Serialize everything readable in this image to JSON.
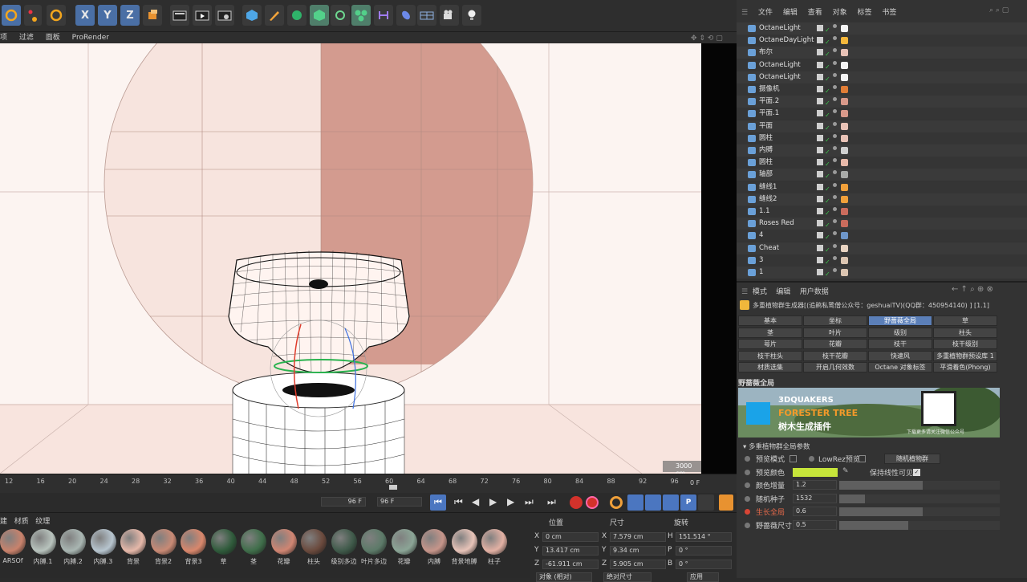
{
  "toolbar": {
    "axes": [
      "X",
      "Y",
      "Z"
    ]
  },
  "viewport_menu": [
    "项",
    "过滤",
    "面板",
    "ProRender"
  ],
  "viewport": {
    "hud_distance": "3000 cm"
  },
  "timeline": {
    "ticks": [
      "12",
      "16",
      "20",
      "24",
      "28",
      "32",
      "36",
      "40",
      "44",
      "48",
      "52",
      "56",
      "60",
      "64",
      "68",
      "72",
      "76",
      "80",
      "84",
      "88",
      "92",
      "96"
    ],
    "end_frame": "0 F"
  },
  "playbar": {
    "frame_a": "96 F",
    "frame_b": "96 F"
  },
  "materials": [
    {
      "label": "ARSOf",
      "color": "#c9826c"
    },
    {
      "label": "内膊.1",
      "color": "#b8c3bd"
    },
    {
      "label": "内膊.2",
      "color": "#a9b6b2"
    },
    {
      "label": "内膊.3",
      "color": "#b7c5cf"
    },
    {
      "label": "背景",
      "color": "#e6b8a9"
    },
    {
      "label": "背景2",
      "color": "#c98a75"
    },
    {
      "label": "背景3",
      "color": "#d9876c"
    },
    {
      "label": "草",
      "color": "#2f5b3b"
    },
    {
      "label": "茎",
      "color": "#3f6e4a"
    },
    {
      "label": "花瓣",
      "color": "#d08572"
    },
    {
      "label": "柱头",
      "color": "#6b4a3d"
    },
    {
      "label": "级别多边",
      "color": "#3f5a4a"
    },
    {
      "label": "叶片多边",
      "color": "#5c7a68"
    },
    {
      "label": "花瓣",
      "color": "#8ba596"
    },
    {
      "label": "内膊",
      "color": "#c6958a"
    },
    {
      "label": "背景地膊",
      "color": "#e7c3b8"
    },
    {
      "label": "柱子",
      "color": "#e3b1a4"
    }
  ],
  "coords": {
    "headers": [
      "位置",
      "尺寸",
      "旋转"
    ],
    "rows": [
      {
        "axis": "X",
        "pos": "0 cm",
        "size": "7.579 cm",
        "rot_label": "H",
        "rot": "151.514 °"
      },
      {
        "axis": "Y",
        "pos": "13.417 cm",
        "size": "9.34 cm",
        "rot_label": "P",
        "rot": "0 °"
      },
      {
        "axis": "Z",
        "pos": "-61.911 cm",
        "size": "5.905 cm",
        "rot_label": "B",
        "rot": "0 °"
      }
    ],
    "footer_a": "对象 (相对)",
    "footer_b": "绝对尺寸",
    "footer_c": "应用"
  },
  "object_manager": {
    "menu": [
      "文件",
      "编辑",
      "查看",
      "对象",
      "标签",
      "书签"
    ],
    "objects": [
      {
        "name": "OctaneLight",
        "tag": "#f4f4f4"
      },
      {
        "name": "OctaneDayLight",
        "tag": "#f5b73b"
      },
      {
        "name": "布尔",
        "tag": "#e8c2b6"
      },
      {
        "name": "OctaneLight",
        "tag": "#f4f4f4"
      },
      {
        "name": "OctaneLight",
        "tag": "#f4f4f4"
      },
      {
        "name": "摄像机",
        "tag": "#e07d36"
      },
      {
        "name": "平面.2",
        "tag": "#d8998a"
      },
      {
        "name": "平面.1",
        "tag": "#d8998a"
      },
      {
        "name": "平面",
        "tag": "#e8c2b6"
      },
      {
        "name": "圆柱",
        "tag": "#e8c2b6"
      },
      {
        "name": "内膊",
        "tag": "#cfcfcf"
      },
      {
        "name": "圆柱",
        "tag": "#e8b9a9"
      },
      {
        "name": "轴部",
        "tag": "#a8aaa8"
      },
      {
        "name": "缝线1",
        "tag": "#f0a03a"
      },
      {
        "name": "缝线2",
        "tag": "#f0a03a"
      },
      {
        "name": "1.1",
        "tag": "#cb6c5d"
      },
      {
        "name": "Roses Red",
        "tag": "#cb6c5d"
      },
      {
        "name": "4",
        "tag": "#6e96c9"
      },
      {
        "name": "Cheat",
        "tag": "#e8d3c1"
      },
      {
        "name": "3",
        "tag": "#dcc5b1"
      },
      {
        "name": "1",
        "tag": "#dcc5b1"
      }
    ]
  },
  "attribute_manager": {
    "menu": [
      "模式",
      "编辑",
      "用户数据"
    ],
    "title": "多重植物群生成器[(追鹃私鸷僧公众号：geshuaiTV)(QQ群：450954140) ] [1.1]",
    "tabs": [
      [
        "基本",
        "坐标",
        "野蔷薇全局",
        "草"
      ],
      [
        "茎",
        "叶片",
        "级别",
        "柱头"
      ],
      [
        "萼片",
        "花瓣",
        "枝干",
        "枝干级别"
      ],
      [
        "枝干柱头",
        "枝干花瓣",
        "快速风",
        "多重植物群预设库 1"
      ],
      [
        "材质选集",
        "开启几何效数",
        "Octane 对象标签",
        "平滑着色(Phong)"
      ]
    ],
    "section": "野蔷薇全局",
    "banner": {
      "brand": "3DQUAKERS",
      "title": "FORESTER TREE",
      "subtitle": "树木生成插件",
      "note": "下载更多请关注微信公众号"
    },
    "group": "多重植物群全局参数",
    "params": [
      {
        "label": "预览模式",
        "value": "",
        "extra": "LowRez预览",
        "extra2": "随机植物群"
      },
      {
        "label": "预览颜色",
        "value": "",
        "extra": "保持线性可见",
        "color": "#c6e53a"
      },
      {
        "label": "颜色增量",
        "value": "1.2",
        "fill": 0.52
      },
      {
        "label": "随机种子",
        "value": "1532",
        "fill": 0.16
      },
      {
        "label": "生长全局",
        "value": "0.6",
        "fill": 0.52
      },
      {
        "label": "野蔷薇尺寸",
        "value": "0.5",
        "fill": 0.43
      }
    ]
  }
}
